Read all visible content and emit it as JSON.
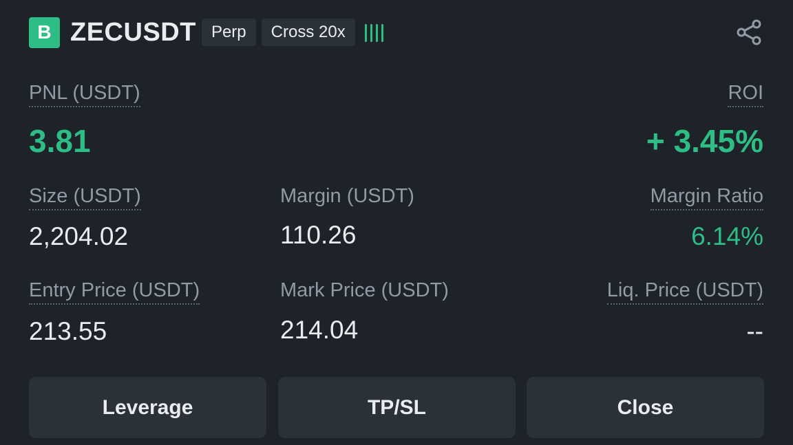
{
  "header": {
    "side_badge": "B",
    "symbol": "ZECUSDT",
    "type_tag": "Perp",
    "margin_tag": "Cross 20x",
    "share_icon": "share-icon"
  },
  "pnl": {
    "label": "PNL (USDT)",
    "value": "3.81"
  },
  "roi": {
    "label": "ROI",
    "value": "+ 3.45%"
  },
  "size": {
    "label": "Size (USDT)",
    "value": "2,204.02"
  },
  "margin": {
    "label": "Margin (USDT)",
    "value": "110.26"
  },
  "margin_ratio": {
    "label": "Margin Ratio",
    "value": "6.14%"
  },
  "entry_price": {
    "label": "Entry Price (USDT)",
    "value": "213.55"
  },
  "mark_price": {
    "label": "Mark Price (USDT)",
    "value": "214.04"
  },
  "liq_price": {
    "label": "Liq. Price (USDT)",
    "value": "--"
  },
  "buttons": {
    "leverage": "Leverage",
    "tpsl": "TP/SL",
    "close": "Close"
  },
  "colors": {
    "background": "#1e2329",
    "positive": "#2ebd85",
    "button": "#2b3139",
    "muted_text": "#929aa5"
  }
}
